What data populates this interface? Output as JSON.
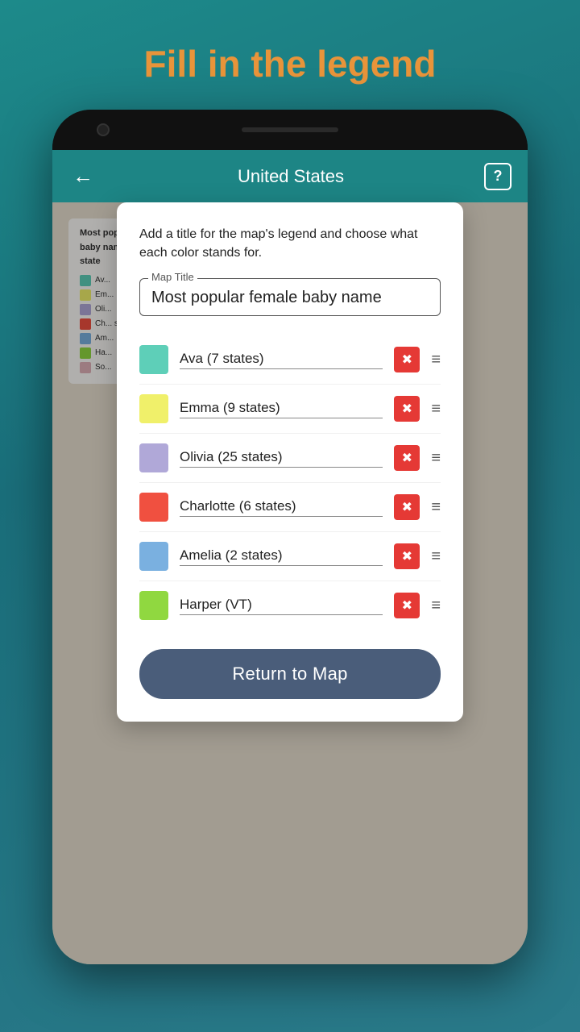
{
  "page": {
    "title": "Fill in the legend",
    "bg_color": "#1d8a8a"
  },
  "app_header": {
    "title": "United States",
    "back_label": "←",
    "help_label": "?"
  },
  "modal": {
    "description": "Add a title for the map's legend and choose what each color stands for.",
    "input_label": "Map Title",
    "input_value": "Most popular female baby name",
    "return_button_label": "Return to Map"
  },
  "legend_items": [
    {
      "id": 1,
      "color": "#5ecfb8",
      "text": "Ava (7 states)"
    },
    {
      "id": 2,
      "color": "#f0f06a",
      "text": "Emma (9 states)"
    },
    {
      "id": 3,
      "color": "#b0a8d8",
      "text": "Olivia (25 states)"
    },
    {
      "id": 4,
      "color": "#f05040",
      "text": "Charlotte (6 states)"
    },
    {
      "id": 5,
      "color": "#7ab0e0",
      "text": "Amelia (2 states)"
    },
    {
      "id": 6,
      "color": "#90d840",
      "text": "Harper (VT)"
    }
  ],
  "map_legend_mini": {
    "title": "Most popular female baby name by state",
    "items": [
      {
        "color": "#5ecfb8",
        "label": "Av..."
      },
      {
        "color": "#f0f06a",
        "label": "Em..."
      },
      {
        "color": "#b0a8d8",
        "label": "Oli..."
      },
      {
        "color": "#f05040",
        "label": "Ch... sta..."
      },
      {
        "color": "#7ab0e0",
        "label": "Am..."
      },
      {
        "color": "#90d840",
        "label": "Ha..."
      },
      {
        "color": "#e0b0b8",
        "label": "So..."
      }
    ]
  }
}
